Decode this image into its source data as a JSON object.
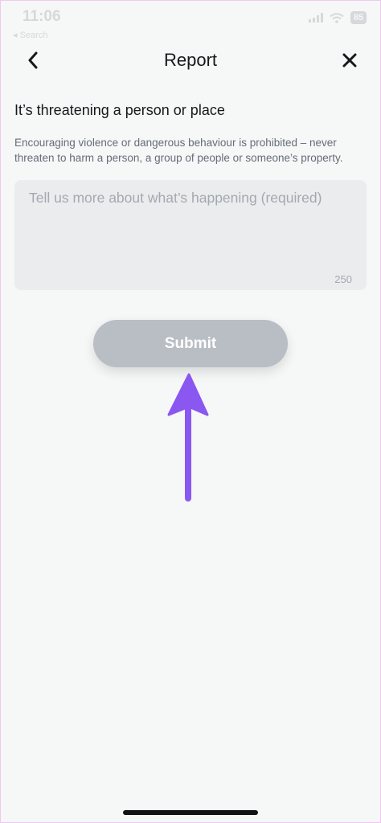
{
  "status_bar": {
    "time": "11:06",
    "back_app": "◂ Search",
    "battery": "85"
  },
  "header": {
    "title": "Report"
  },
  "report": {
    "reason_title": "It’s threatening a person or place",
    "reason_description": "Encouraging violence or dangerous behaviour is prohibited – never threaten to harm a person, a group of people or someone’s property.",
    "details_placeholder": "Tell us more about what’s happening (required)",
    "details_value": "",
    "char_limit": "250",
    "submit_label": "Submit"
  },
  "colors": {
    "background": "#f6f7f7",
    "submit_disabled": "#b9bec4",
    "annotation_arrow": "#8a57f0"
  },
  "icons": [
    "back-chevron-icon",
    "close-icon",
    "signal-icon",
    "wifi-icon",
    "battery-icon",
    "arrow-up-annotation-icon"
  ]
}
